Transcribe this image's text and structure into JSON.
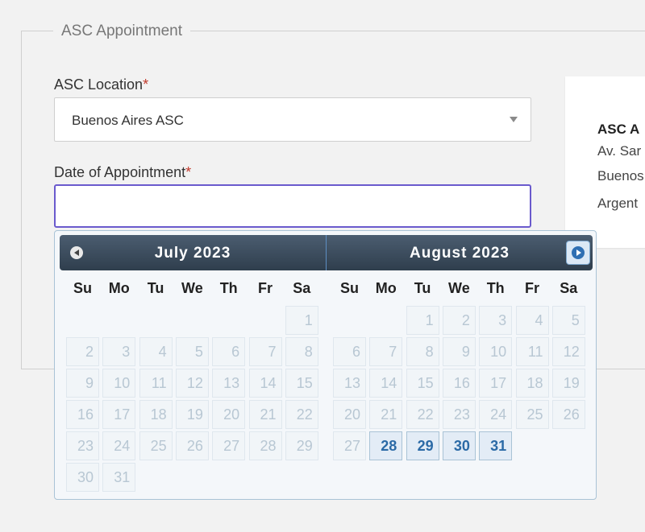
{
  "form": {
    "legend": "ASC Appointment",
    "location_label": "ASC Location",
    "location_required": "*",
    "location_value": "Buenos Aires ASC",
    "date_label": "Date of Appointment",
    "date_required": "*",
    "date_value": ""
  },
  "location_card": {
    "name": "ASC A",
    "address_line1": "Av. Sar",
    "address_line2": "Buenos",
    "address_line3": "Argent"
  },
  "datepicker": {
    "days_of_week": [
      "Su",
      "Mo",
      "Tu",
      "We",
      "Th",
      "Fr",
      "Sa"
    ],
    "months": [
      {
        "title": "July 2023",
        "first_weekday": 6,
        "days": 31,
        "selectable_from": 32
      },
      {
        "title": "August 2023",
        "first_weekday": 2,
        "days": 31,
        "selectable_from": 28
      }
    ]
  },
  "colors": {
    "accent_border": "#6a5acd",
    "header_bg": "#2f3e4d",
    "active_text": "#2b6aa6",
    "disabled_text": "#b8c7d3",
    "required": "#c0392b"
  }
}
